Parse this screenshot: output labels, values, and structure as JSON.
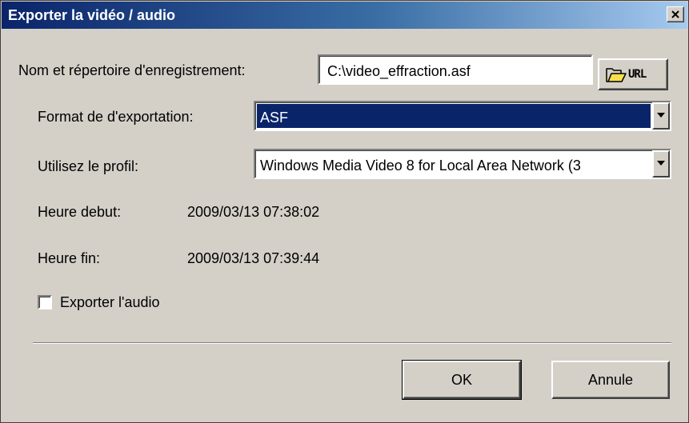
{
  "window": {
    "title": "Exporter la vidéo / audio",
    "close_glyph": "×"
  },
  "form": {
    "name_label": "Nom et répertoire d'enregistrement:",
    "name_value": "C:\\video_effraction.asf",
    "browse_button_text": "URL",
    "format_label": "Format de d'exportation:",
    "format_value": "ASF",
    "profile_label": "Utilisez le profil:",
    "profile_value": "Windows Media Video 8 for Local Area Network (3",
    "start_label": "Heure debut:",
    "start_value": "2009/03/13 07:38:02",
    "end_label": "Heure fin:",
    "end_value": "2009/03/13 07:39:44",
    "audio_label": "Exporter l'audio",
    "audio_checked": false
  },
  "buttons": {
    "ok_label": "OK",
    "cancel_label": "Annule"
  },
  "colors": {
    "title_bar": "#0a246a",
    "selection": "#0a246a",
    "face": "#d4d0c8"
  }
}
